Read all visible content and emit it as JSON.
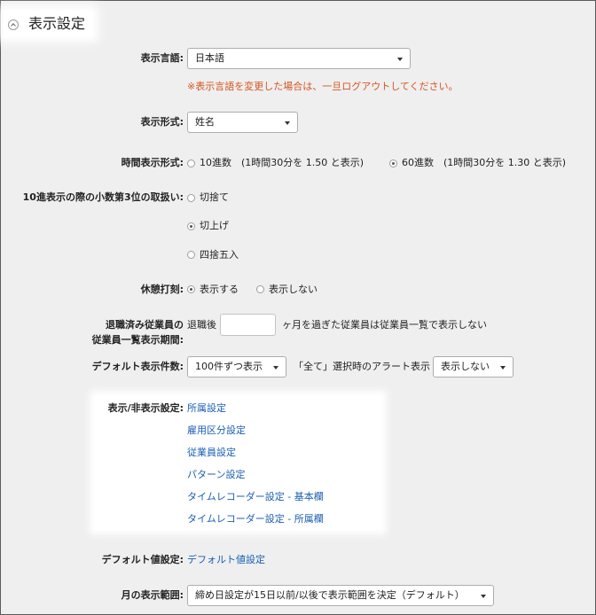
{
  "section": {
    "title": "表示設定"
  },
  "display_language": {
    "label": "表示言語:",
    "value": "日本語",
    "note": "※表示言語を変更した場合は、一旦ログアウトしてください。"
  },
  "display_format": {
    "label": "表示形式:",
    "value": "姓名"
  },
  "time_format": {
    "label": "時間表示形式:",
    "options": [
      {
        "label": "10進数　(1時間30分を 1.50 と表示)",
        "selected": false
      },
      {
        "label": "60進数　(1時間30分を 1.30 と表示)",
        "selected": true
      }
    ]
  },
  "decimal_rounding": {
    "label": "10進表示の際の小数第3位の取扱い:",
    "options": [
      {
        "label": "切捨て",
        "selected": false
      },
      {
        "label": "切上げ",
        "selected": true
      },
      {
        "label": "四捨五入",
        "selected": false
      }
    ]
  },
  "break_stamp": {
    "label": "休憩打刻:",
    "options": [
      {
        "label": "表示する",
        "selected": true
      },
      {
        "label": "表示しない",
        "selected": false
      }
    ]
  },
  "retired_employees": {
    "label_line1": "退職済み従業員の",
    "label_line2": "従業員一覧表示期間:",
    "prefix": "退職後",
    "months_value": "",
    "suffix": "ヶ月を過ぎた従業員は従業員一覧で表示しない"
  },
  "default_count": {
    "label": "デフォルト表示件数:",
    "value": "100件ずつ表示",
    "alert_label": "「全て」選択時のアラート表示",
    "alert_value": "表示しない"
  },
  "visibility": {
    "label": "表示/非表示設定:",
    "links": [
      "所属設定",
      "雇用区分設定",
      "従業員設定",
      "パターン設定",
      "タイムレコーダー設定 - 基本欄",
      "タイムレコーダー設定 - 所属欄"
    ]
  },
  "default_values": {
    "label": "デフォルト値設定:",
    "link": "デフォルト値設定"
  },
  "month_range": {
    "label": "月の表示範囲:",
    "value": "締め日設定が15日以前/以後で表示範囲を決定（デフォルト）"
  }
}
